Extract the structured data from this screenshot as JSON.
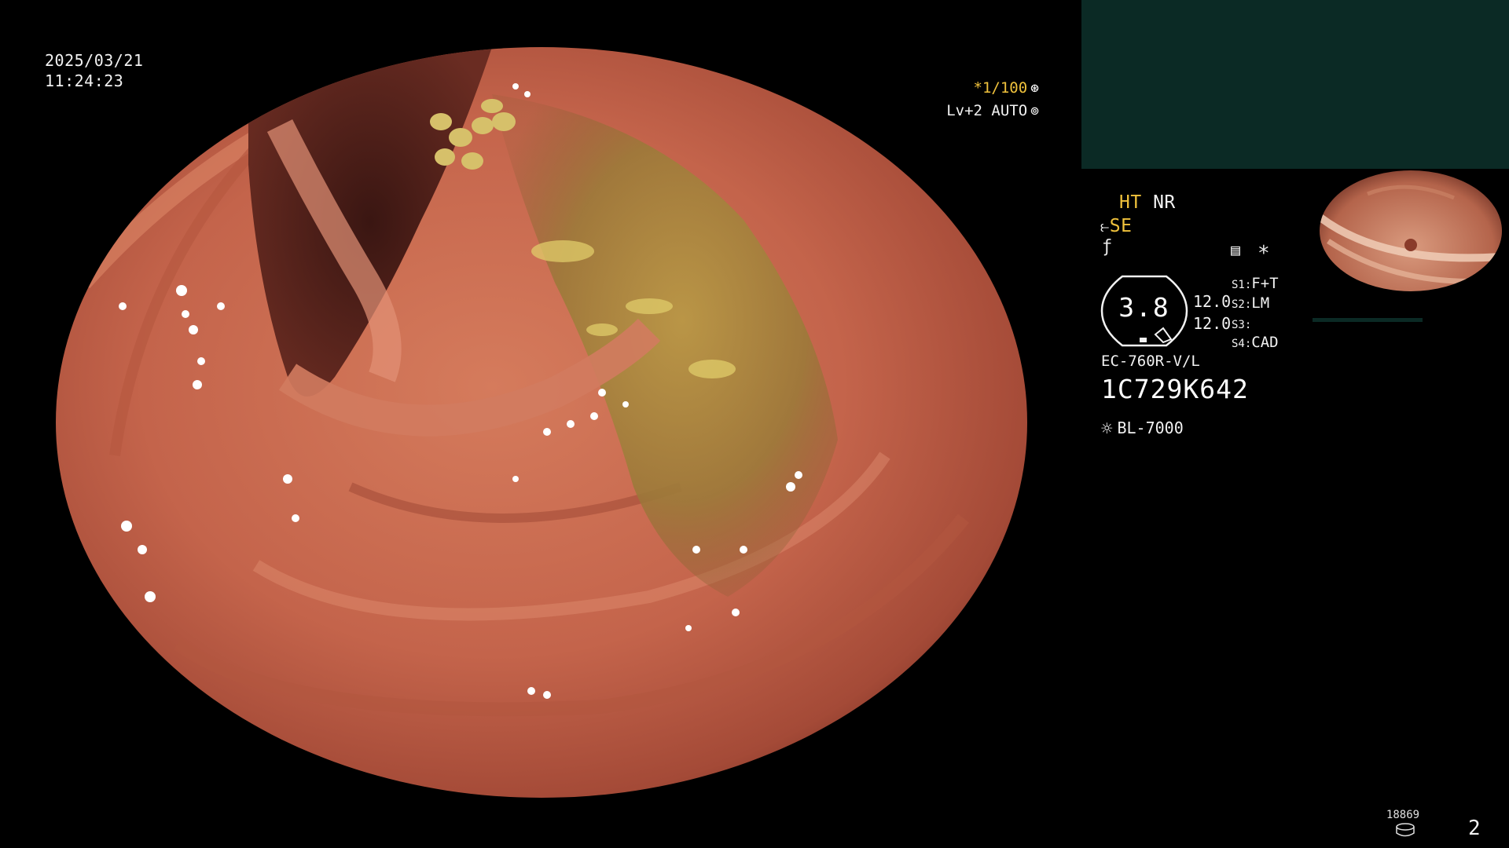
{
  "overlay": {
    "date": "2025/03/21",
    "time": "11:24:23",
    "shutter": "*1/100",
    "shutter_icon": "aperture-icon",
    "level": "Lv+2 AUTO",
    "level_icon": "iris-icon"
  },
  "panel": {
    "mode_ht": "HT",
    "mode_nr": "NR",
    "mode_se": "SE",
    "mode_se_icon": "se-enhance-icon",
    "mode_f_icon": "f-function-icon",
    "record_icon": "record-memo-icon",
    "asterisk": "*",
    "value": "3.8",
    "num1": "12.0",
    "num2": "12.0",
    "switches": [
      {
        "key": "S1:",
        "value": "F+T"
      },
      {
        "key": "S2:",
        "value": "LM"
      },
      {
        "key": "S3:",
        "value": ""
      },
      {
        "key": "S4:",
        "value": "CAD"
      }
    ],
    "scope_model": "EC-760R-V/L",
    "serial": "1C729K642",
    "light_source": "BL-7000",
    "light_icon": "sun-light-icon"
  },
  "footer": {
    "counter": "18869",
    "counter_icon": "storage-icon",
    "page": "2"
  },
  "colors": {
    "accent_yellow": "#f0c23c",
    "top_panel": "#0b2a25",
    "mucosa": "#c86a50"
  }
}
